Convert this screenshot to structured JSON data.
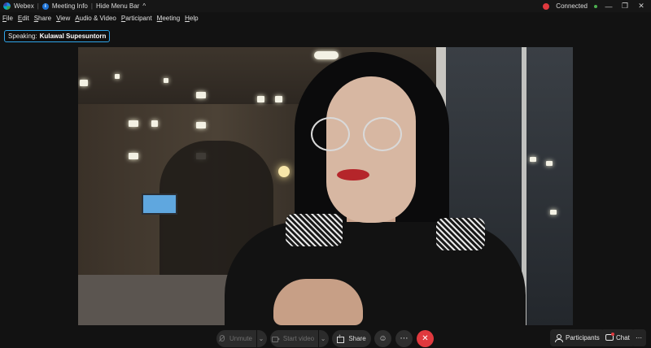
{
  "titlebar": {
    "app_name": "Webex",
    "meeting_info": "Meeting Info",
    "hide_menu_bar": "Hide Menu Bar",
    "chevron": "^",
    "status": "Connected",
    "window_buttons": [
      "—",
      "❐",
      "✕"
    ]
  },
  "menu": [
    {
      "hot": "F",
      "rest": "ile"
    },
    {
      "hot": "E",
      "rest": "dit"
    },
    {
      "hot": "S",
      "rest": "hare"
    },
    {
      "hot": "V",
      "rest": "iew"
    },
    {
      "hot": "A",
      "rest": "udio & Video"
    },
    {
      "hot": "P",
      "rest": "articipant"
    },
    {
      "hot": "M",
      "rest": "eeting"
    },
    {
      "hot": "H",
      "rest": "elp"
    }
  ],
  "speaking": {
    "label": "Speaking:",
    "name": "Kulawal Supesuntorn"
  },
  "controls": {
    "unmute": "Unmute",
    "start_video": "Start video",
    "share": "Share",
    "reactions_icon": "☺",
    "more_icon": "⋯",
    "end_icon": "✕",
    "caret": "⌄"
  },
  "side": {
    "participants": "Participants",
    "chat": "Chat",
    "more": "⋯"
  },
  "colors": {
    "accent": "#2ea3e8",
    "end_call": "#e0393e",
    "connected": "#4caf50"
  }
}
